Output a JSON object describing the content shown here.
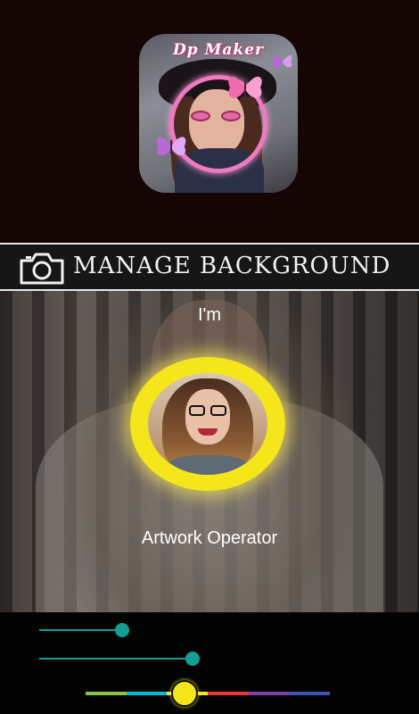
{
  "app": {
    "logo_text": "Dp Maker"
  },
  "header": {
    "title": "MANAGE BACKGROUND",
    "icon": "camera-icon"
  },
  "preview": {
    "prefix_text": "I'm",
    "role_text": "Artwork Operator",
    "ring_color": "#f5e51b"
  },
  "controls": {
    "slider_1": {
      "value": 0.31
    },
    "slider_2": {
      "value": 0.42
    },
    "slider_color": "#139f95",
    "color_picker": {
      "colors": [
        "#8bc34a",
        "#00bcd4",
        "#f5e51b",
        "#e53935",
        "#7b3fb0",
        "#3f51b5"
      ],
      "selected_color": "#f5e51b"
    }
  }
}
